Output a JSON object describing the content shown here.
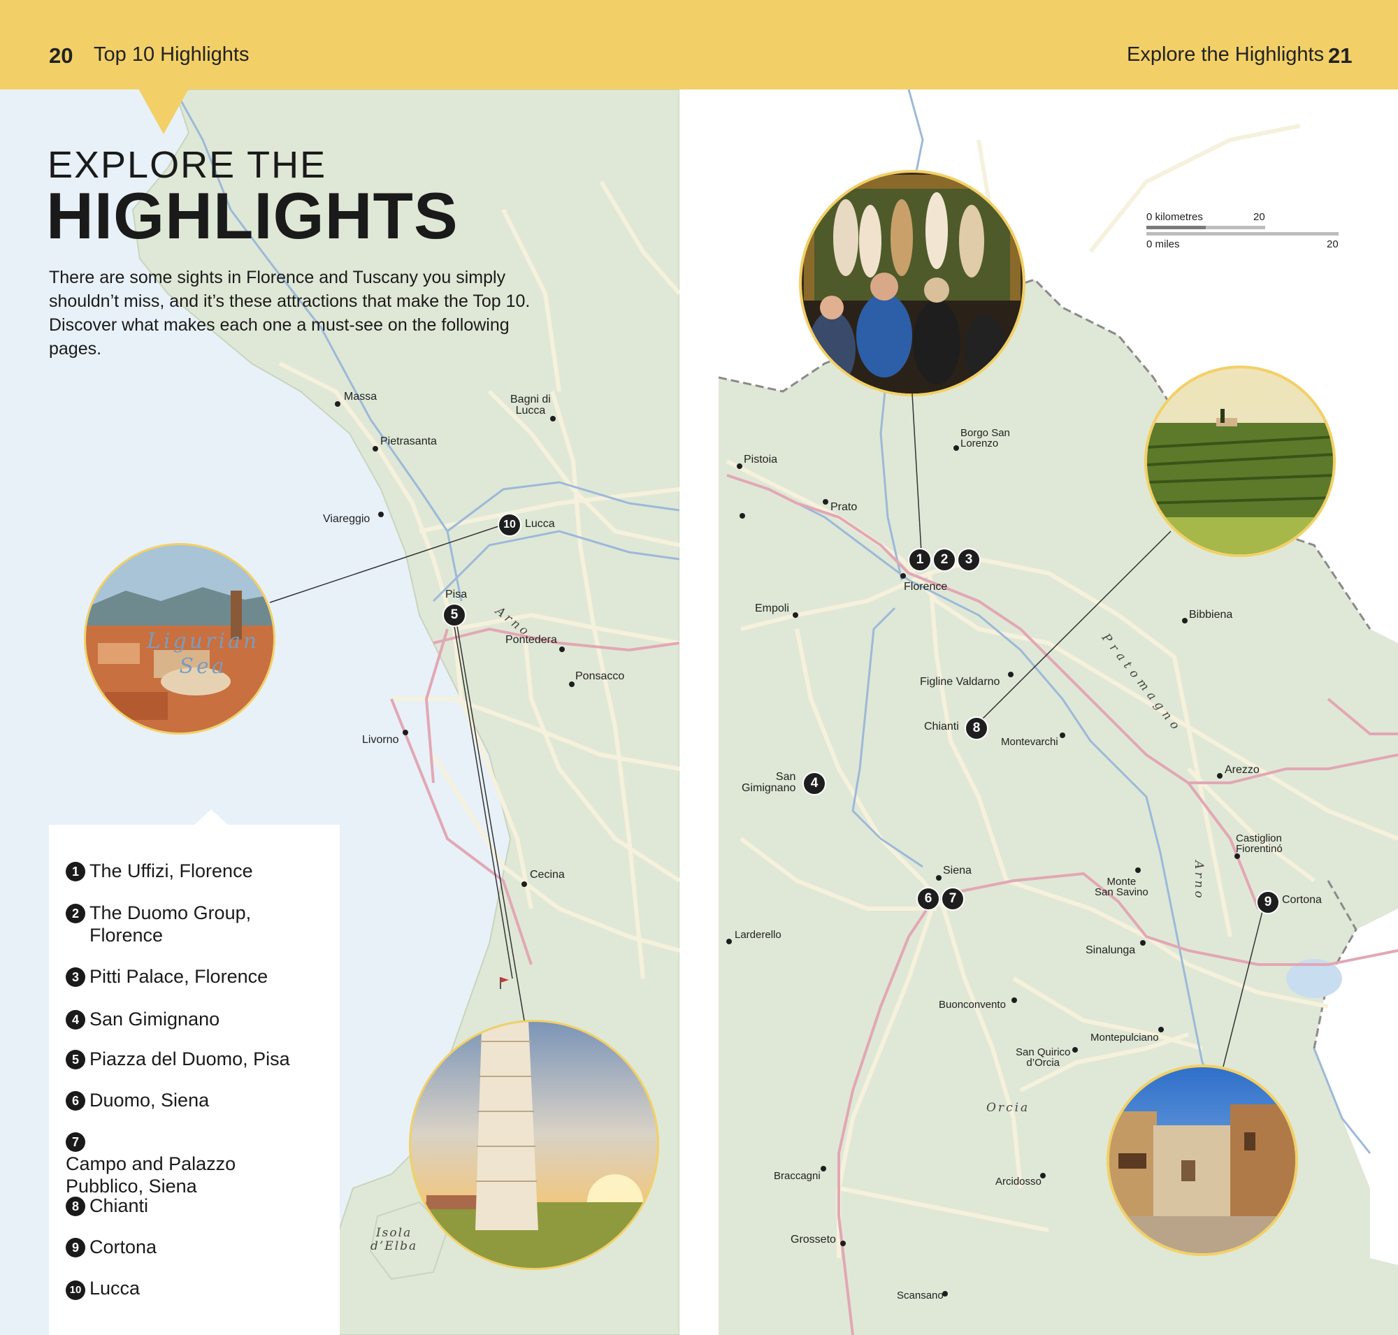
{
  "header": {
    "left_page_number": "20",
    "left_title": "Top 10 Highlights",
    "right_title": "Explore the Highlights",
    "right_page_number": "21"
  },
  "title": {
    "line1": "EXPLORE THE",
    "line2": "HIGHLIGHTS"
  },
  "intro": "There are some sights in Florence and Tuscany you simply shouldn’t miss, and it’s these attractions that make the Top 10. Discover what makes each one a must-see on the following pages.",
  "sea_label": {
    "line1": "Ligurian",
    "line2": "Sea"
  },
  "places": {
    "massa": "Massa",
    "bagni_line1": "Bagni di",
    "bagni_line2": "Lucca",
    "pietrasanta": "Pietrasanta",
    "viareggio": "Viareggio",
    "lucca": "Lucca",
    "pisa": "Pisa",
    "pontedera": "Pontedera",
    "ponsacco": "Ponsacco",
    "livorno": "Livorno",
    "cecina": "Cecina",
    "pistoia": "Pistoia",
    "prato": "Prato",
    "borgo_line1": "Borgo San",
    "borgo_line2": "Lorenzo",
    "florence": "Florence",
    "empoli": "Empoli",
    "bibbiena": "Bibbiena",
    "figline": "Figline Valdarno",
    "chianti": "Chianti",
    "montevarchi": "Montevarchi",
    "san_gim_line1": "San",
    "san_gim_line2": "Gimignano",
    "arezzo": "Arezzo",
    "castiglion_line1": "Castiglion",
    "castiglion_line2": "Fiorentinó",
    "siena": "Siena",
    "monte_line1": "Monte",
    "monte_line2": "San Savino",
    "cortona": "Cortona",
    "larderello": "Larderello",
    "sinalunga": "Sinalunga",
    "buonconvento": "Buonconvento",
    "montepulciano": "Montepulciano",
    "sanquirico_line1": "San Quirico",
    "sanquirico_line2": "d’Orcia",
    "braccagni": "Braccagni",
    "arcidosso": "Arcidosso",
    "grosseto": "Grosseto",
    "scansano": "Scansano"
  },
  "water_labels": {
    "arno_west": "Arno",
    "arno_east": "Arno",
    "pratomagno": "Pratomagno",
    "orcia": "Orcia",
    "isola_line1": "Isola",
    "isola_line2": "d’Elba"
  },
  "scale": {
    "km_label": "0 kilometres",
    "km_value": "20",
    "mi_label": "0 miles",
    "mi_value": "20"
  },
  "markers": {
    "m1": "1",
    "m2": "2",
    "m3": "3",
    "m4": "4",
    "m5": "5",
    "m6": "6",
    "m7": "7",
    "m8": "8",
    "m9": "9",
    "m10": "10"
  },
  "highlights": [
    {
      "num": "1",
      "name": "The Uffizi, Florence"
    },
    {
      "num": "2",
      "name": "The Duomo Group, Florence"
    },
    {
      "num": "3",
      "name": "Pitti Palace, Florence"
    },
    {
      "num": "4",
      "name": "San Gimignano"
    },
    {
      "num": "5",
      "name": "Piazza del Duomo, Pisa"
    },
    {
      "num": "6",
      "name": "Duomo, Siena"
    },
    {
      "num": "7",
      "name": "Campo and Palazzo Pubblico, Siena"
    },
    {
      "num": "8",
      "name": "Chianti"
    },
    {
      "num": "9",
      "name": "Cortona"
    },
    {
      "num": "10",
      "name": "Lucca"
    }
  ],
  "colors": {
    "header": "#f2d067",
    "land": "#dfe8d6",
    "sea": "#e8f1f8",
    "road_major": "#e2a7b5",
    "road_minor": "#f6f1dc",
    "river": "#9cb9d9",
    "photo_border": "#f2d067",
    "marker": "#1e1e1e"
  }
}
